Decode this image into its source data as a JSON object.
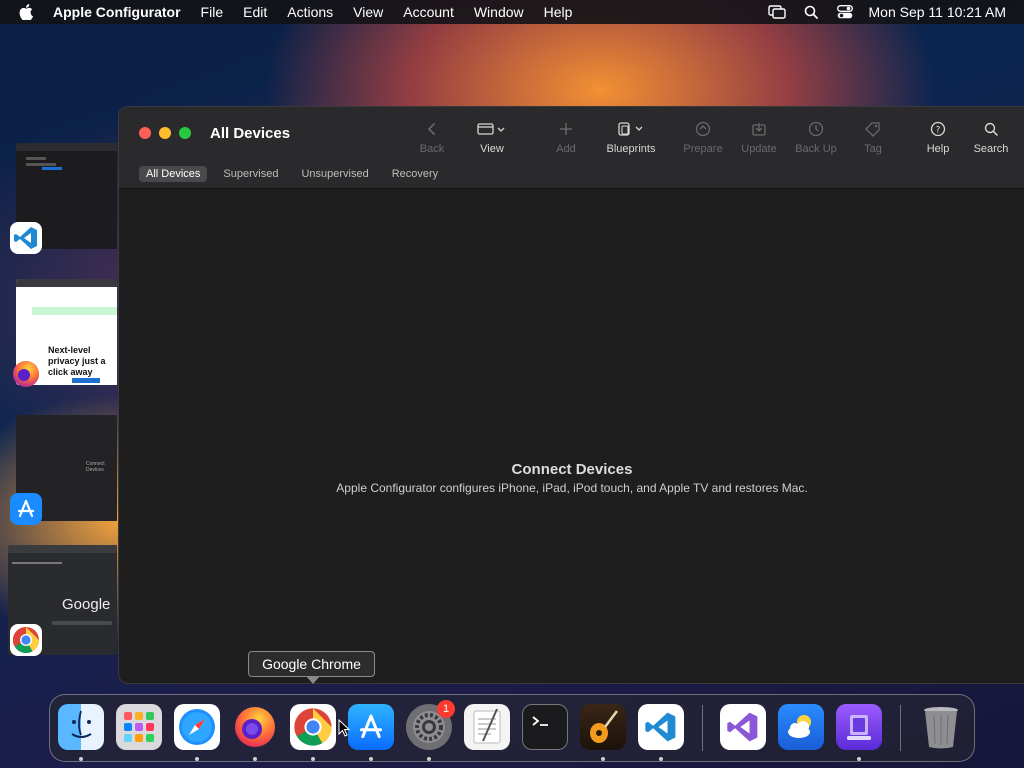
{
  "menubar": {
    "app_name": "Apple Configurator",
    "menus": [
      "File",
      "Edit",
      "Actions",
      "View",
      "Account",
      "Window",
      "Help"
    ],
    "clock": "Mon Sep 11  10:21 AM",
    "status_icons": [
      "screen-mirroring-icon",
      "search-icon",
      "control-center-icon"
    ]
  },
  "window": {
    "title": "All Devices",
    "toolbar": [
      {
        "label": "Back",
        "icon": "chevron-left-icon",
        "enabled": false
      },
      {
        "label": "View",
        "icon": "view-mode-icon",
        "enabled": true
      },
      {
        "label": "Add",
        "icon": "plus-icon",
        "enabled": false
      },
      {
        "label": "Blueprints",
        "icon": "blueprints-icon",
        "enabled": true
      },
      {
        "label": "Prepare",
        "icon": "prepare-icon",
        "enabled": false
      },
      {
        "label": "Update",
        "icon": "update-icon",
        "enabled": false
      },
      {
        "label": "Back Up",
        "icon": "backup-icon",
        "enabled": false
      },
      {
        "label": "Tag",
        "icon": "tag-icon",
        "enabled": false
      },
      {
        "label": "Help",
        "icon": "help-icon",
        "enabled": true
      },
      {
        "label": "Search",
        "icon": "search-icon",
        "enabled": true
      }
    ],
    "tabs": [
      "All Devices",
      "Supervised",
      "Unsupervised",
      "Recovery"
    ],
    "active_tab": "All Devices",
    "empty_state": {
      "title": "Connect Devices",
      "subtitle": "Apple Configurator configures iPhone, iPad, iPod touch, and Apple TV and restores Mac."
    }
  },
  "thumbnails": {
    "firefox_text": "Next-level privacy just a click away",
    "chrome_text": "Google",
    "connect_text": "Connect Devices"
  },
  "tooltip": "Google Chrome",
  "dock": {
    "items": [
      "Finder",
      "Launchpad",
      "Safari",
      "Firefox",
      "Google Chrome",
      "App Store",
      "System Settings",
      "TextEdit",
      "Terminal",
      "GarageBand",
      "Visual Studio Code",
      "Visual Studio",
      "Weather",
      "Apple Configurator",
      "Trash"
    ],
    "system_settings_badge": "1"
  },
  "colors": {
    "close": "#fe5f57",
    "minimize": "#febc2e",
    "zoom": "#28c840",
    "badge": "#ff3b30",
    "vscode": "#1f8ad2",
    "appstore": "#1a8cff"
  }
}
